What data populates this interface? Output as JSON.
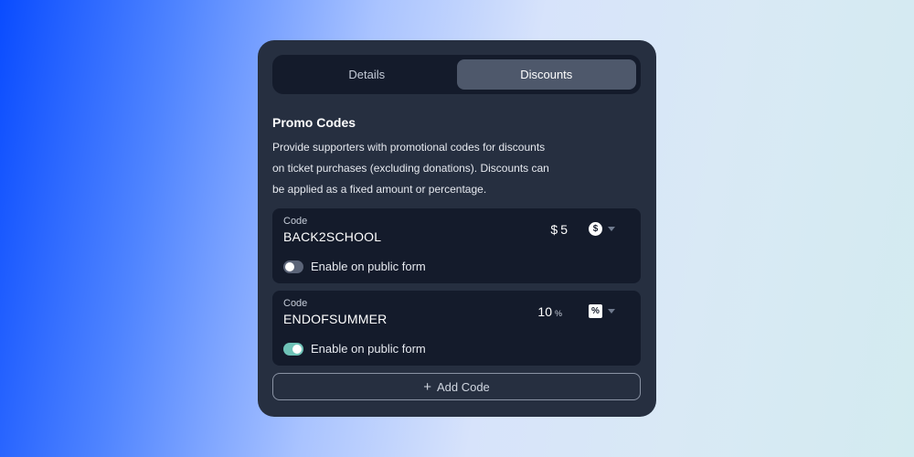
{
  "tabs": [
    {
      "label": "Details",
      "active": false
    },
    {
      "label": "Discounts",
      "active": true
    }
  ],
  "section": {
    "title": "Promo Codes",
    "description": "Provide supporters with promotional codes for discounts on ticket purchases (excluding donations). Discounts can be applied as a fixed amount or percentage."
  },
  "codes": [
    {
      "field_label": "Code",
      "code": "BACK2SCHOOL",
      "currency_prefix": "$",
      "amount": "5",
      "type_icon": "dollar-circle-icon",
      "toggle_label": "Enable on public form",
      "enabled": false
    },
    {
      "field_label": "Code",
      "code": "ENDOFSUMMER",
      "amount": "10",
      "percent_suffix": "%",
      "type_icon": "percent-icon",
      "toggle_label": "Enable on public form",
      "enabled": true
    }
  ],
  "add_button": {
    "label": "Add Code"
  },
  "colors": {
    "card": "#262f40",
    "panel": "#141b2b",
    "active_tab": "#4e586b",
    "toggle_on": "#6ec2b7",
    "toggle_off": "#5b6478"
  }
}
